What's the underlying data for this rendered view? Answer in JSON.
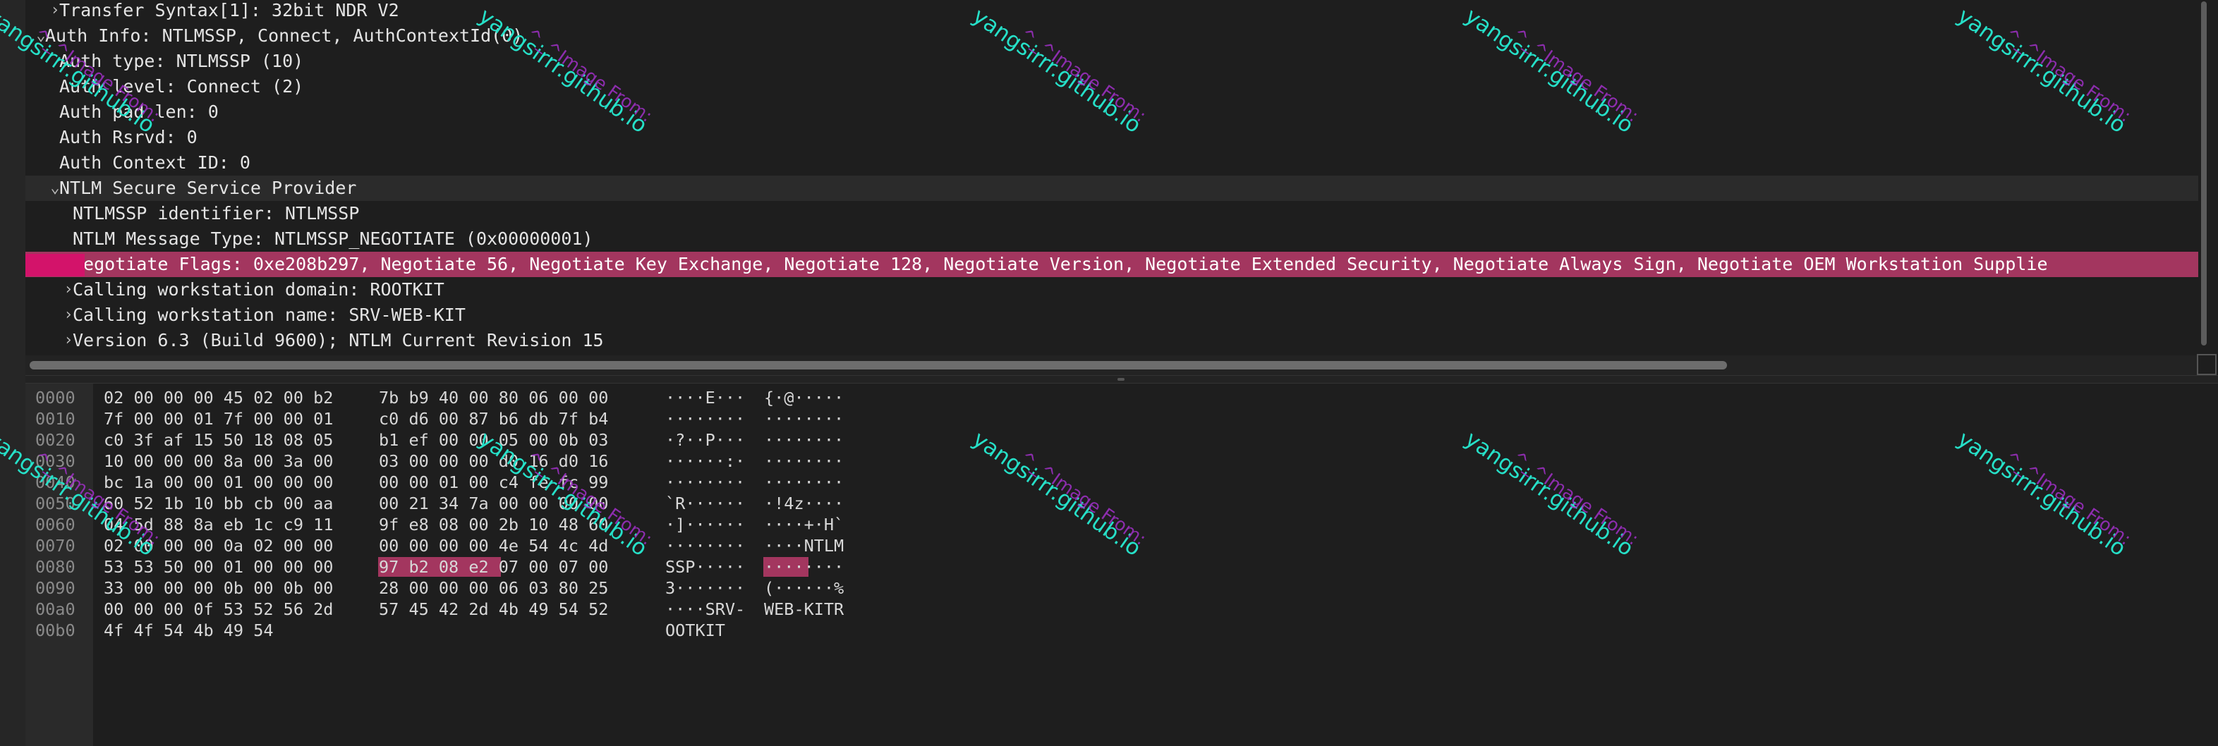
{
  "details": {
    "rows": [
      {
        "toggle": "›",
        "label": "Transfer Syntax[1]: 32bit NDR V2"
      },
      {
        "toggle": "⌄",
        "label": "Auth Info: NTLMSSP, Connect, AuthContextId(0)"
      },
      {
        "toggle": "",
        "label": "Auth type: NTLMSSP (10)"
      },
      {
        "toggle": "",
        "label": "Auth level: Connect (2)"
      },
      {
        "toggle": "",
        "label": "Auth pad len: 0"
      },
      {
        "toggle": "",
        "label": "Auth Rsrvd: 0"
      },
      {
        "toggle": "",
        "label": "Auth Context ID: 0"
      },
      {
        "toggle": "⌄",
        "label": "NTLM Secure Service Provider"
      },
      {
        "toggle": "",
        "label": "NTLMSSP identifier: NTLMSSP"
      },
      {
        "toggle": "",
        "label": "NTLM Message Type: NTLMSSP_NEGOTIATE (0x00000001)"
      },
      {
        "toggle": "›",
        "label": "Negotiate Flags: 0xe208b297, Negotiate 56, Negotiate Key Exchange, Negotiate 128, Negotiate Version, Negotiate Extended Security, Negotiate Always Sign, Negotiate OEM Workstation Supplie"
      },
      {
        "toggle": "›",
        "label": "Calling workstation domain: ROOTKIT"
      },
      {
        "toggle": "›",
        "label": "Calling workstation name: SRV-WEB-KIT"
      },
      {
        "toggle": "›",
        "label": "Version 6.3 (Build 9600); NTLM Current Revision 15"
      }
    ]
  },
  "hex": {
    "lines": [
      {
        "offset": "0000",
        "hex1": "02 00 00 00 45 02 00 b2",
        "hex2": "7b b9 40 00 80 06 00 00",
        "ascii1": "····E···",
        "ascii2": "{·@·····"
      },
      {
        "offset": "0010",
        "hex1": "7f 00 00 01 7f 00 00 01",
        "hex2": "c0 d6 00 87 b6 db 7f b4",
        "ascii1": "········",
        "ascii2": "········"
      },
      {
        "offset": "0020",
        "hex1": "c0 3f af 15 50 18 08 05",
        "hex2": "b1 ef 00 00 05 00 0b 03",
        "ascii1": "·?··P···",
        "ascii2": "········"
      },
      {
        "offset": "0030",
        "hex1": "10 00 00 00 8a 00 3a 00",
        "hex2": "03 00 00 00 d0 16 d0 16",
        "ascii1": "······:·",
        "ascii2": "········"
      },
      {
        "offset": "0040",
        "hex1": "bc 1a 00 00 01 00 00 00",
        "hex2": "00 00 01 00 c4 fe fc 99",
        "ascii1": "········",
        "ascii2": "········"
      },
      {
        "offset": "0050",
        "hex1": "60 52 1b 10 bb cb 00 aa",
        "hex2": "00 21 34 7a 00 00 00 00",
        "ascii1": "`R······",
        "ascii2": "·!4z····"
      },
      {
        "offset": "0060",
        "hex1": "04 5d 88 8a eb 1c c9 11",
        "hex2": "9f e8 08 00 2b 10 48 60",
        "ascii1": "·]······",
        "ascii2": "····+·H`"
      },
      {
        "offset": "0070",
        "hex1": "02 00 00 00 0a 02 00 00",
        "hex2": "00 00 00 00 4e 54 4c 4d",
        "ascii1": "········",
        "ascii2": "····NTLM"
      },
      {
        "offset": "0080",
        "hex1": "53 53 50 00 01 00 00 00",
        "hex2": "97 b2 08 e2 07 00 07 00",
        "ascii1": "SSP·····",
        "ascii2": "········"
      },
      {
        "offset": "0090",
        "hex1": "33 00 00 00 0b 00 0b 00",
        "hex2": "28 00 00 00 06 03 80 25",
        "ascii1": "3·······",
        "ascii2": "(······%"
      },
      {
        "offset": "00a0",
        "hex1": "00 00 00 0f 53 52 56 2d",
        "hex2": "57 45 42 2d 4b 49 54 52",
        "ascii1": "····SRV-",
        "ascii2": "WEB-KITR"
      },
      {
        "offset": "00b0",
        "hex1": "4f 4f 54 4b 49 54",
        "hex2": "",
        "ascii1": "OOTKIT",
        "ascii2": ""
      }
    ]
  },
  "watermark": {
    "line1": "^_^Image From:",
    "line2": "yangsirrr.github.io"
  }
}
